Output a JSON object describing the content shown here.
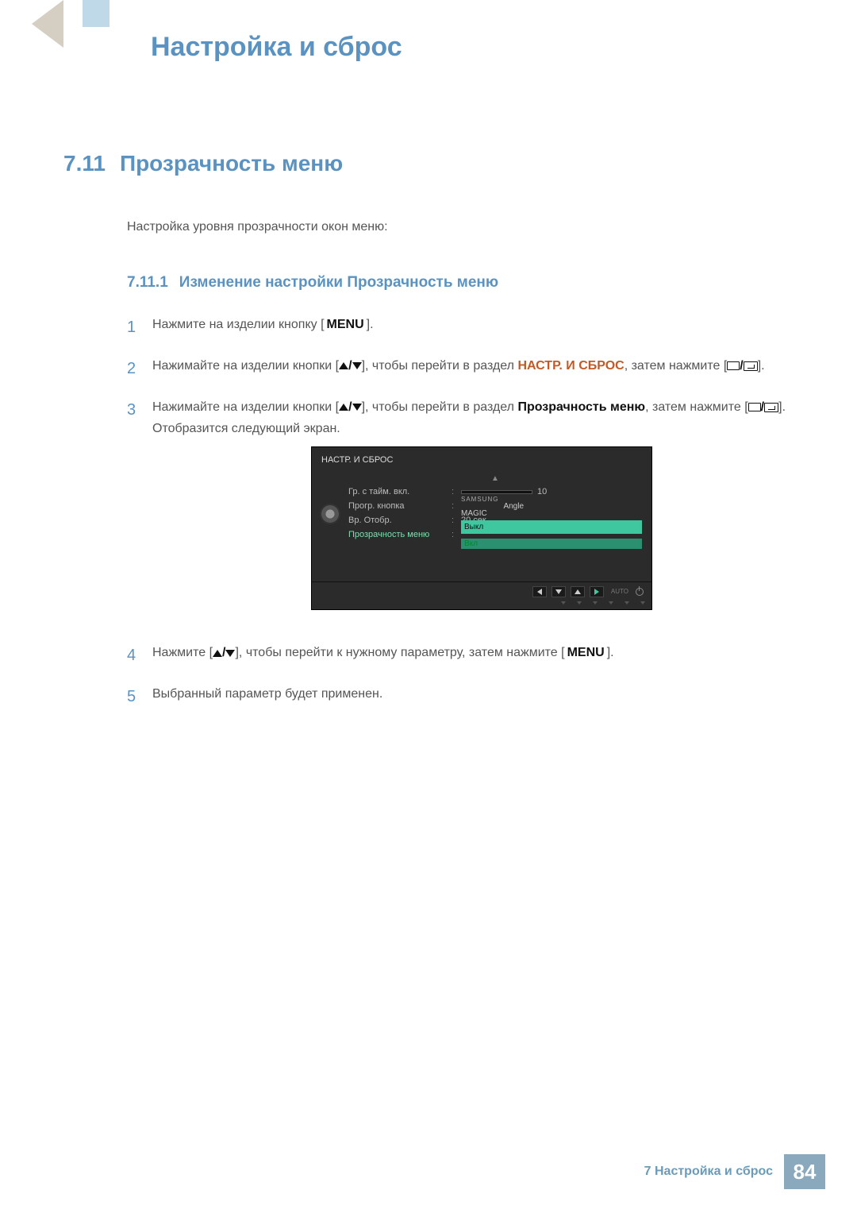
{
  "chapter_title": "Настройка и сброс",
  "section": {
    "number": "7.11",
    "title": "Прозрачность меню"
  },
  "intro": "Настройка уровня прозрачности окон меню:",
  "subsection": {
    "number": "7.11.1",
    "title": "Изменение настройки Прозрачность меню"
  },
  "steps": {
    "s1": {
      "text_a": "Нажмите на изделии кнопку [",
      "menu": "MENU",
      "text_b": "]."
    },
    "s2": {
      "text_a": "Нажимайте на изделии кнопки [",
      "text_b": "], чтобы перейти в раздел ",
      "target": "НАСТР. И СБРОС",
      "text_c": ", затем нажмите [",
      "text_d": "]."
    },
    "s3": {
      "text_a": "Нажимайте на изделии кнопки [",
      "text_b": "], чтобы перейти в раздел ",
      "target": "Прозрачность меню",
      "text_c": ", затем нажмите [",
      "text_d": "].",
      "after": "Отобразится следующий экран."
    },
    "s4": {
      "text_a": "Нажмите [",
      "text_b": "], чтобы перейти к нужному параметру, затем нажмите [",
      "menu": "MENU",
      "text_c": "]."
    },
    "s5": {
      "text": "Выбранный параметр будет применен."
    }
  },
  "osd": {
    "title": "НАСТР. И СБРОС",
    "rows": {
      "timer": {
        "label": "Гр. с тайм. вкл.",
        "value": "10"
      },
      "progkey": {
        "label": "Прогр. кнопка",
        "brand": "SAMSUNG",
        "magic": "MAGIC",
        "angle": "Angle"
      },
      "disptime": {
        "label": "Вр. Отобр.",
        "value": "20 сек."
      },
      "transp": {
        "label": "Прозрачность меню",
        "opt1": "Выкл",
        "opt2": "Вкл"
      }
    },
    "nav_auto": "AUTO"
  },
  "footer": {
    "chapter_ref": "7 Настройка и сброс",
    "page": "84"
  }
}
